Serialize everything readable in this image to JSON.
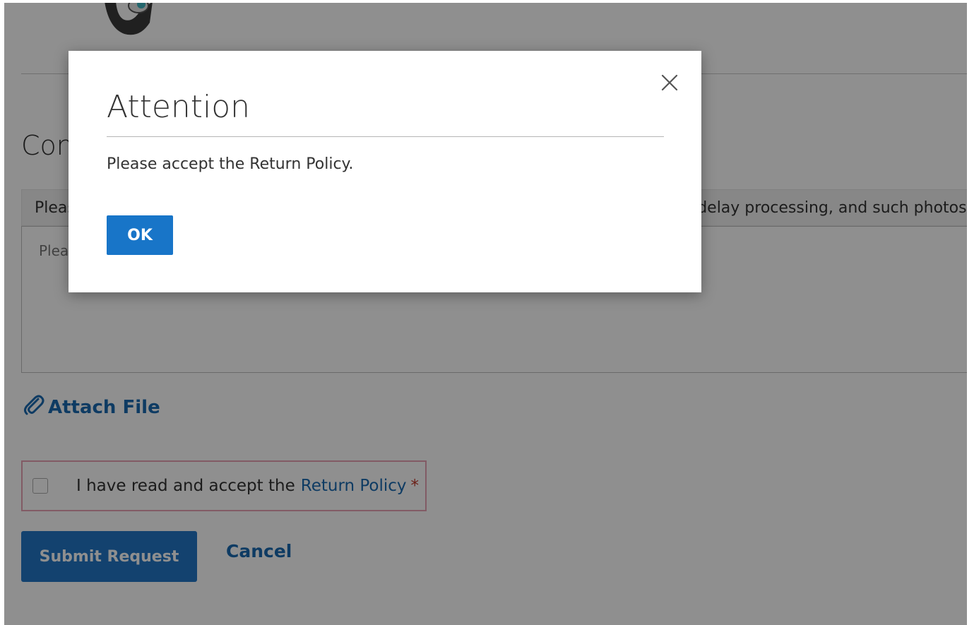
{
  "page": {
    "section_heading": "Comments",
    "instructions": "Please describe the issue and attach photos. Note that blurry or unclear photos may delay processing, and such photos may not be approved.",
    "comments_placeholder": "Please enter your comments here...",
    "attach_file_label": "Attach File",
    "policy": {
      "prefix": "I have read and accept the",
      "link_label": "Return Policy",
      "required_mark": "*"
    },
    "submit_label": "Submit Request",
    "cancel_label": "Cancel"
  },
  "modal": {
    "title": "Attention",
    "message": "Please accept the Return Policy.",
    "ok_label": "OK"
  },
  "colors": {
    "accent": "#1875c8",
    "link": "#1a6ab0",
    "required": "#c0392b",
    "error_border": "#e8a3b4",
    "overlay": "rgba(0,0,0,0.44)"
  },
  "icons": {
    "close": "close-icon",
    "attach": "paperclip-icon",
    "product": "product-thumbnail"
  }
}
